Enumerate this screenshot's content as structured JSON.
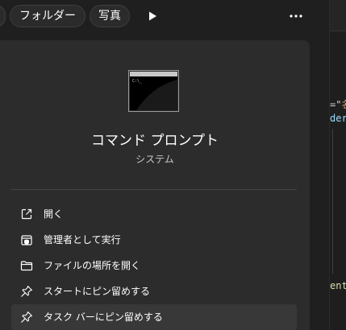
{
  "filters": {
    "cut_chip_label": "",
    "folder_label": "フォルダー",
    "photo_label": "写真"
  },
  "app": {
    "title": "コマンド プロンプト",
    "subtitle": "システム"
  },
  "menu": {
    "items": [
      {
        "label": "開く",
        "icon": "open-external-icon"
      },
      {
        "label": "管理者として実行",
        "icon": "shield-admin-icon"
      },
      {
        "label": "ファイルの場所を開く",
        "icon": "folder-icon"
      },
      {
        "label": "スタートにピン留めする",
        "icon": "pin-icon"
      },
      {
        "label": "タスク バーにピン留めする",
        "icon": "pin-icon"
      }
    ]
  },
  "editor": {
    "line1_prefix": "=\"",
    "line1_string": "名",
    "line2": "der",
    "line3": "ent"
  },
  "colors": {
    "background": "#1f1f1f",
    "card": "#2c2c2c",
    "hover": "#383838"
  }
}
